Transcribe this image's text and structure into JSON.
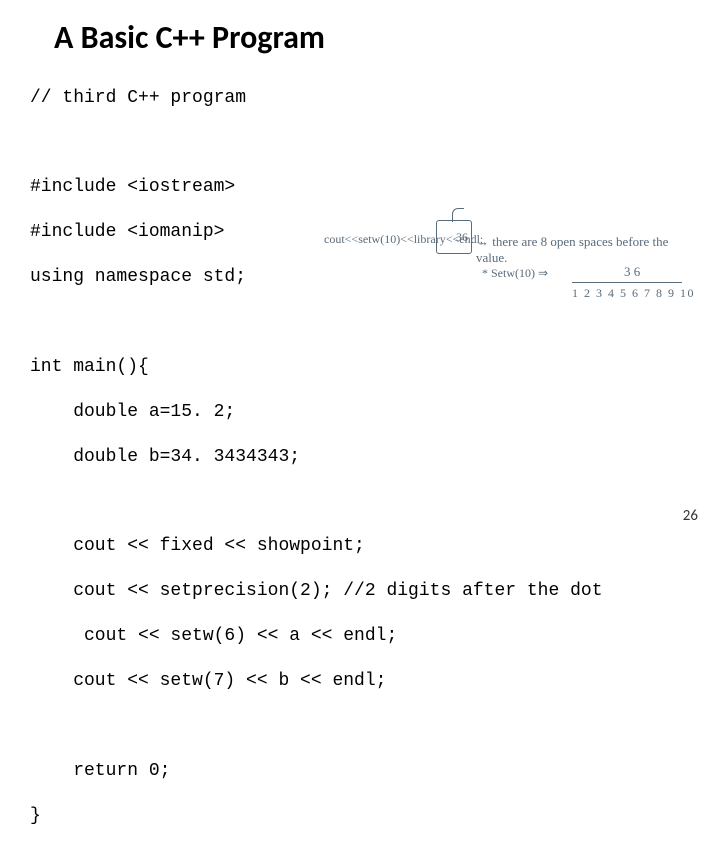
{
  "title": "A Basic C++ Program",
  "code": {
    "comment": "// third C++ program",
    "inc1": "#include <iostream>",
    "inc2": "#include <iomanip>",
    "using": "using namespace std;",
    "main": "int main(){",
    "decl_a": "    double a=15. 2;",
    "decl_b": "    double b=34. 3434343;",
    "cout1": "    cout << fixed << showpoint;",
    "cout2": "    cout << setprecision(2); //2 digits after the dot",
    "cout3": "     cout << setw(6) << a << endl;",
    "cout4": "    cout << setw(7) << b << endl;",
    "ret": "    return 0;",
    "close": "}"
  },
  "annotation": {
    "row1_left": "cout<<setw(10)<<library<<endl;",
    "box_value": "36",
    "arrow_text": "→ there are 8 open spaces before the value.",
    "row2_left": "* Setw(10) ⇒",
    "row2_right": "3 6",
    "row3": "1 2 3 4 5 6 7 8 9 10"
  },
  "page_number": "26"
}
